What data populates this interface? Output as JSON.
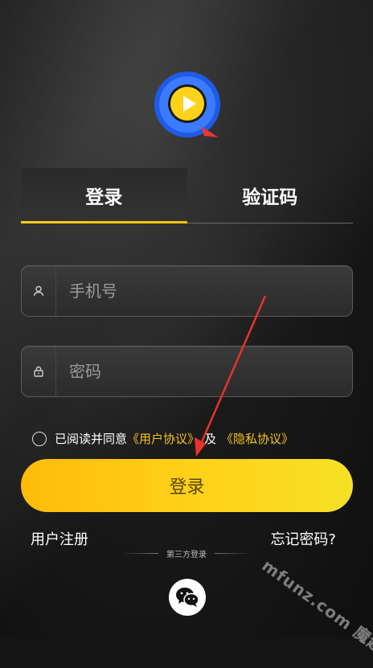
{
  "tabs": [
    {
      "label": "登录",
      "active": true
    },
    {
      "label": "验证码",
      "active": false
    }
  ],
  "phone": {
    "placeholder": "手机号",
    "icon": "user-icon"
  },
  "password": {
    "placeholder": "密码",
    "icon": "lock-icon"
  },
  "agreement": {
    "prefix": "已阅读并同意",
    "user_agreement": "《用户协议》",
    "and": "及",
    "privacy_policy": "《隐私协议》"
  },
  "login_button": "登录",
  "register_link": "用户注册",
  "forgot_link": "忘记密码?",
  "third_party_label": "第三方登录",
  "wechat": {
    "icon": "wechat-icon"
  },
  "watermark": "mfunz.com 魔趣网",
  "colors": {
    "accent": "#f5c518",
    "button_start": "#ffbb0a",
    "button_end": "#f6e126",
    "logo_blue": "#1f5be8",
    "logo_yellow": "#ffd21a"
  }
}
